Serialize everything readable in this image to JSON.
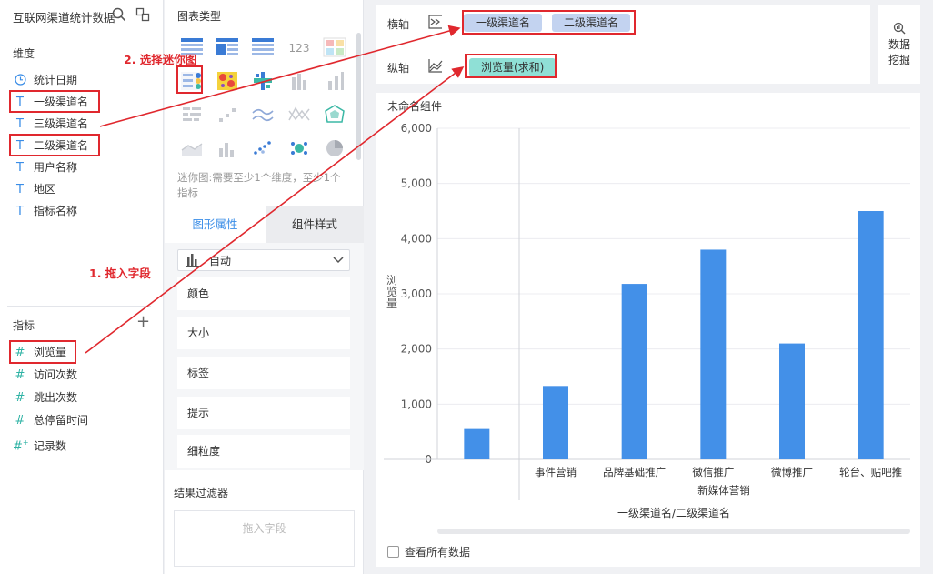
{
  "left": {
    "dataset_title": "互联网渠道统计数据",
    "dimensions_title": "维度",
    "dimensions": [
      {
        "label": "统计日期",
        "icon": "clock-icon"
      },
      {
        "label": "一级渠道名",
        "icon": "text-type-icon"
      },
      {
        "label": "三级渠道名",
        "icon": "text-type-icon"
      },
      {
        "label": "二级渠道名",
        "icon": "text-type-icon"
      },
      {
        "label": "用户名称",
        "icon": "text-type-icon"
      },
      {
        "label": "地区",
        "icon": "text-type-icon"
      },
      {
        "label": "指标名称",
        "icon": "text-type-icon"
      }
    ],
    "measures_title": "指标",
    "measures": [
      {
        "label": "浏览量",
        "icon": "number-type-icon"
      },
      {
        "label": "访问次数",
        "icon": "number-type-icon"
      },
      {
        "label": "跳出次数",
        "icon": "number-type-icon"
      },
      {
        "label": "总停留时间",
        "icon": "number-type-icon"
      },
      {
        "label": "记录数",
        "icon": "record-count-icon"
      }
    ]
  },
  "middle": {
    "chart_type_title": "图表类型",
    "mini_chart_desc": "迷你图:需要至少1个维度，至少1个指标",
    "tabs": [
      "图形属性",
      "组件样式"
    ],
    "auto_label": "自动",
    "props": [
      "颜色",
      "大小",
      "标签",
      "提示",
      "细粒度"
    ],
    "filter_title": "结果过滤器",
    "filter_placeholder": "拖入字段"
  },
  "axes": {
    "x_label": "横轴",
    "y_label": "纵轴",
    "x_fields": [
      "一级渠道名",
      "二级渠道名"
    ],
    "y_fields": [
      "浏览量(求和)"
    ]
  },
  "mining_button": [
    "数据",
    "挖掘"
  ],
  "component": {
    "title": "未命名组件",
    "view_all": "查看所有数据"
  },
  "annotations": {
    "step1": "1. 拖入字段",
    "step2": "2. 选择迷你图"
  },
  "colors": {
    "accent": "#3a8de7",
    "bar": "#4390e8",
    "annotation": "#e0282e",
    "x_pill": "#c3d3f0",
    "y_pill": "#8fe0d6"
  },
  "chart_data": {
    "type": "bar",
    "ylabel": "浏览量",
    "xlabel": "一级渠道名/二级渠道名",
    "ylim": [
      0,
      6000
    ],
    "yticks": [
      "0",
      "1,000",
      "2,000",
      "3,000",
      "4,000",
      "5,000",
      "6,000"
    ],
    "outer_categories": [
      "",
      "新媒体营销"
    ],
    "categories": [
      "",
      "事件营销",
      "品牌基础推广",
      "微信推广",
      "微博推广",
      "轮台、贴吧推"
    ],
    "values": [
      550,
      1330,
      3180,
      3800,
      2100,
      4500
    ],
    "grid": true
  }
}
